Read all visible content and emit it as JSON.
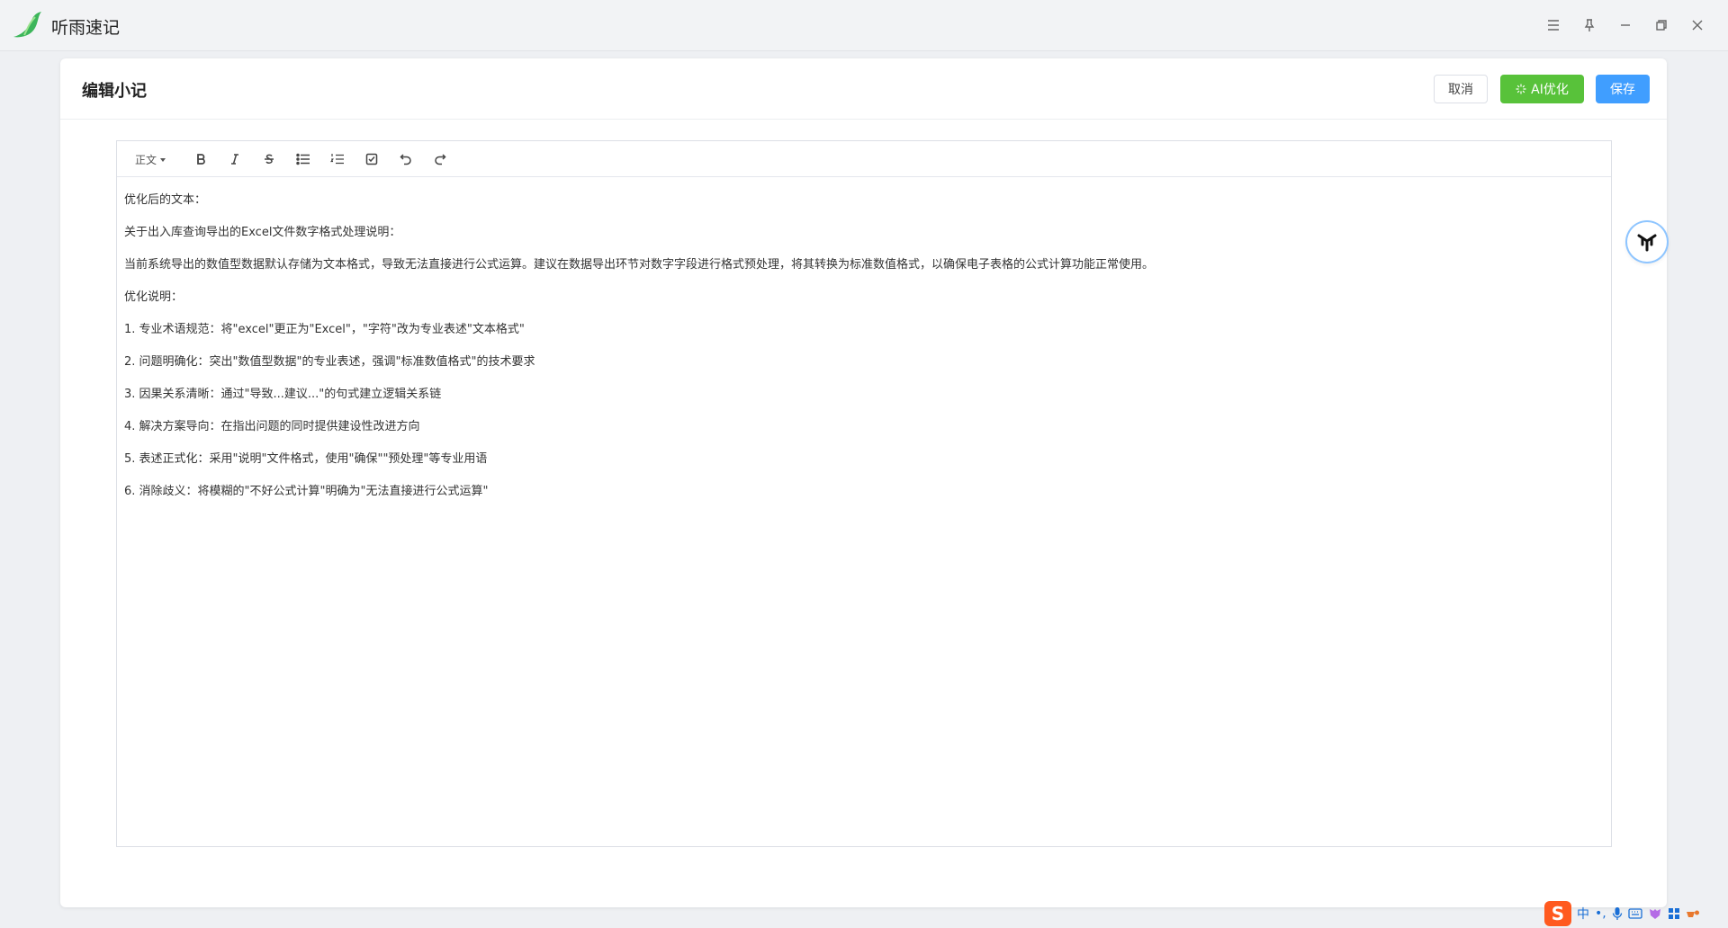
{
  "app": {
    "title": "听雨速记"
  },
  "window_controls": [
    "menu-icon",
    "pin-icon",
    "minimize-icon",
    "restore-icon",
    "close-icon"
  ],
  "card": {
    "title": "编辑小记",
    "buttons": {
      "cancel": "取消",
      "ai": "AI优化",
      "save": "保存"
    }
  },
  "toolbar": {
    "format_label": "正文",
    "icons": [
      "bold-icon",
      "italic-icon",
      "strikethrough-icon",
      "bullet-list-icon",
      "numbered-list-icon",
      "checklist-icon",
      "undo-icon",
      "redo-icon"
    ]
  },
  "editor": {
    "lines": [
      "优化后的文本：",
      "关于出入库查询导出的Excel文件数字格式处理说明：",
      "当前系统导出的数值型数据默认存储为文本格式，导致无法直接进行公式运算。建议在数据导出环节对数字字段进行格式预处理，将其转换为标准数值格式，以确保电子表格的公式计算功能正常使用。",
      "优化说明：",
      "1. 专业术语规范：将\"excel\"更正为\"Excel\"，\"字符\"改为专业表述\"文本格式\"",
      "2. 问题明确化：突出\"数值型数据\"的专业表述，强调\"标准数值格式\"的技术要求",
      "3. 因果关系清晰：通过\"导致...建议...\"的句式建立逻辑关系链",
      "4. 解决方案导向：在指出问题的同时提供建设性改进方向",
      "5. 表述正式化：采用\"说明\"文件格式，使用\"确保\"\"预处理\"等专业用语",
      "6. 消除歧义：将模糊的\"不好公式计算\"明确为\"无法直接进行公式运算\""
    ]
  },
  "ime": {
    "logo": "S",
    "mode": "中",
    "punct": "•,"
  },
  "colors": {
    "ai_button": "#58c23a",
    "save_button": "#409eff",
    "ime_logo": "#ff5a1f"
  }
}
